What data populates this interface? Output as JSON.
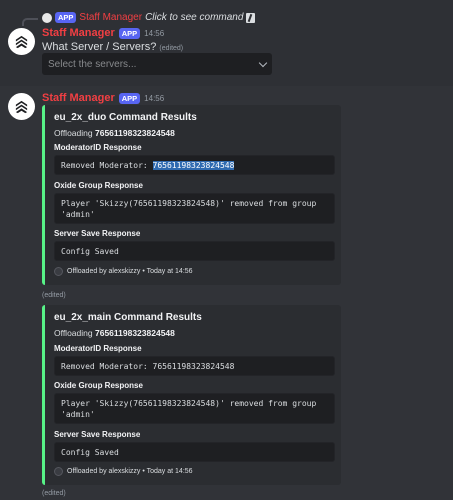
{
  "topbar": {
    "icons": [
      "inbox-icon",
      "link-icon"
    ]
  },
  "interaction": {
    "app_tag": "APP",
    "bot_name": "Staff Manager",
    "prompt": "Click to see command"
  },
  "message1": {
    "username": "Staff Manager",
    "app_tag": "APP",
    "timestamp": "14:56",
    "question": "What Server / Servers?",
    "edited": "(edited)",
    "select_placeholder": "Select the servers..."
  },
  "message2": {
    "username": "Staff Manager",
    "app_tag": "APP",
    "timestamp": "14:56",
    "embeds": [
      {
        "title": "eu_2x_duo Command Results",
        "offloading_label": "Offloading",
        "offloading_id": "76561198323824548",
        "field1_name": "ModeratorID Response",
        "field1_prefix": "Removed Moderator: ",
        "field1_id": "76561198323824548",
        "field2_name": "Oxide Group Response",
        "field2_line1": "Player 'Skizzy(76561198323824548)' removed from group",
        "field2_line2": "'admin'",
        "field3_name": "Server Save Response",
        "field3_value": "Config Saved",
        "footer": "Offloaded by alexskizzy • Today at 14:56",
        "edited": "(edited)"
      },
      {
        "title": "eu_2x_main Command Results",
        "offloading_label": "Offloading",
        "offloading_id": "76561198323824548",
        "field1_name": "ModeratorID Response",
        "field1_prefix": "Removed Moderator: ",
        "field1_id": "76561198323824548",
        "field2_name": "Oxide Group Response",
        "field2_line1": "Player 'Skizzy(76561198323824548)' removed from group",
        "field2_line2": "'admin'",
        "field3_name": "Server Save Response",
        "field3_value": "Config Saved",
        "footer": "Offloaded by alexskizzy • Today at 14:56",
        "edited": "(edited)"
      }
    ]
  },
  "colors": {
    "embed_accent": "#57f287",
    "app_badge": "#5865f2",
    "username": "#f23f43"
  }
}
